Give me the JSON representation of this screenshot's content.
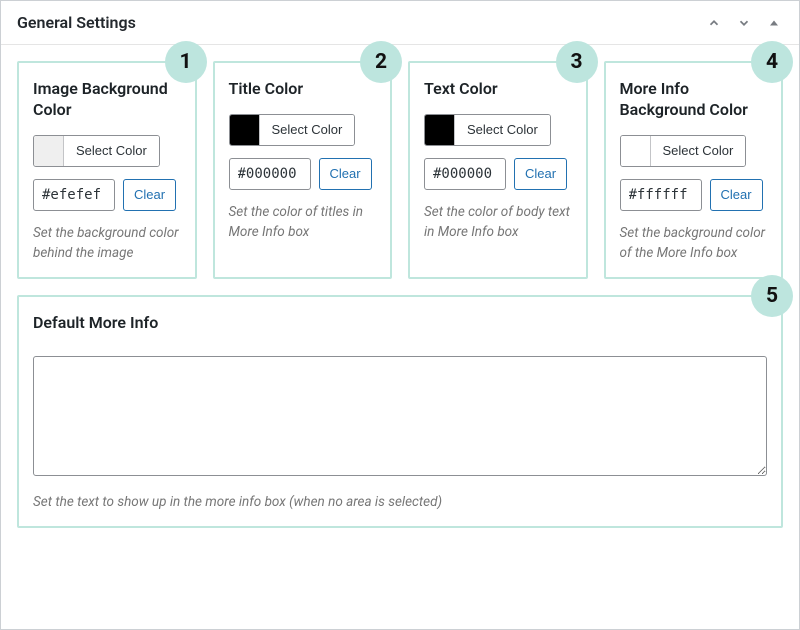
{
  "panel": {
    "title": "General Settings"
  },
  "labels": {
    "select_color": "Select Color",
    "clear": "Clear"
  },
  "cards": [
    {
      "badge": "1",
      "title": "Image Background Color",
      "swatch": "#efefef",
      "value": "#efefef",
      "desc": "Set the background color behind the image"
    },
    {
      "badge": "2",
      "title": "Title Color",
      "swatch": "#000000",
      "value": "#000000",
      "desc": "Set the color of titles in More Info box"
    },
    {
      "badge": "3",
      "title": "Text Color",
      "swatch": "#000000",
      "value": "#000000",
      "desc": "Set the color of body text in More Info box"
    },
    {
      "badge": "4",
      "title": "More Info Background Color",
      "swatch": "#ffffff",
      "value": "#ffffff",
      "desc": "Set the background color of the More Info box"
    }
  ],
  "moreinfo": {
    "badge": "5",
    "title": "Default More Info",
    "value": "",
    "desc": "Set the text to show up in the more info box (when no area is selected)"
  }
}
